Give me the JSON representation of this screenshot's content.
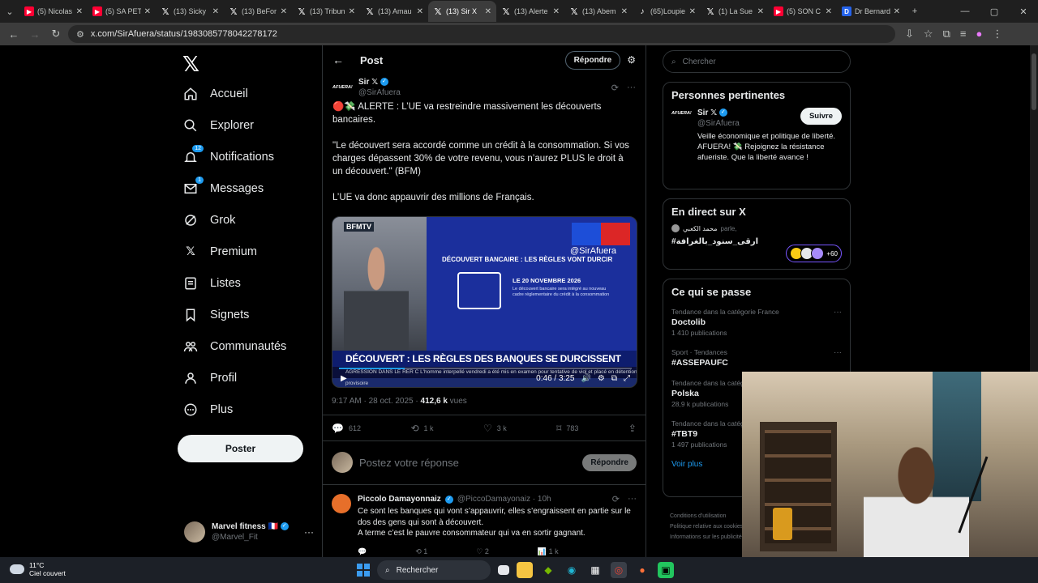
{
  "browser": {
    "tabs": [
      {
        "label": "(5) Nicolas",
        "icon": "youtube-icon"
      },
      {
        "label": "(5) SA PETI",
        "icon": "youtube-icon"
      },
      {
        "label": "(13) Sicky",
        "icon": "x-icon"
      },
      {
        "label": "(13) BeFor",
        "icon": "x-icon"
      },
      {
        "label": "(13) Tribun",
        "icon": "x-icon"
      },
      {
        "label": "(13) Amau",
        "icon": "x-icon"
      },
      {
        "label": "(13) Sir X",
        "icon": "x-icon",
        "active": true
      },
      {
        "label": "(13) Alerte",
        "icon": "x-icon"
      },
      {
        "label": "(13) Abem",
        "icon": "x-icon"
      },
      {
        "label": "(65)Loupie",
        "icon": "tiktok-icon"
      },
      {
        "label": "(1) La Sue",
        "icon": "x-icon"
      },
      {
        "label": "(5) SON C",
        "icon": "youtube-icon"
      },
      {
        "label": "Dr Bernard",
        "icon": "doc-icon"
      }
    ],
    "url": "x.com/SirAfuera/status/1983085778042278172"
  },
  "nav": {
    "items": [
      "Accueil",
      "Explorer",
      "Notifications",
      "Messages",
      "Grok",
      "Premium",
      "Listes",
      "Signets",
      "Communautés",
      "Profil",
      "Plus"
    ],
    "notif_badge": "12",
    "msg_badge": "1",
    "post_button": "Poster",
    "account_name": "Marvel fitness 🇫🇷",
    "account_handle": "@Marvel_Fit"
  },
  "post": {
    "header": "Post",
    "reply_button": "Répondre",
    "author_name": "Sir 𝕏",
    "author_handle": "@SirAfuera",
    "author_logo": "AFUERA!",
    "text_1": "🔴💸 ALERTE : L’UE va restreindre massivement les découverts bancaires.",
    "text_2": "\"Le découvert sera accordé comme un crédit à la consommation. Si vos charges dépassent 30% de votre revenu, vous n’aurez PLUS le droit à un découvert.\" (BFM)",
    "text_3": "L’UE va donc appauvrir des millions de Français.",
    "video": {
      "channel": "BFMTV",
      "handle_overlay": "@SirAfuera",
      "title": "DÉCOUVERT BANCAIRE : LES RÈGLES VONT DURCIR",
      "date": "LE 20 NOVEMBRE 2026",
      "desc": "Le découvert bancaire sera intégré au nouveau cadre réglementaire du crédit à la consommation",
      "banner": "DÉCOUVERT : LES RÈGLES DES BANQUES SE DURCISSENT",
      "ticker": "AGRESSION DANS LE RER C  L'homme interpellé vendredi a été mis en examen pour tentative de viol et placé en détention provisoire",
      "time": "0:46 / 3:25",
      "progress": 0.224
    },
    "timestamp": "9:17 AM · 28 oct. 2025 ·",
    "views_count": "412,6 k",
    "views_label": "vues",
    "stats": {
      "replies": "612",
      "reposts": "1 k",
      "likes": "3 k",
      "bookmarks": "783"
    },
    "reply_placeholder": "Postez votre réponse",
    "reply_submit": "Répondre"
  },
  "comment": {
    "name": "Piccolo Damayonnaiz",
    "handle": "@PiccoDamayonaiz · 10h",
    "text_1": "Ce sont les banques qui vont s’appauvrir, elles s’engraissent en partie sur le dos des gens qui sont à découvert.",
    "text_2": "A terme c’est le pauvre consommateur qui va en sortir gagnant.",
    "replies": "",
    "reposts": "1",
    "likes": "2",
    "views": "1 k"
  },
  "sidebar": {
    "search_placeholder": "Chercher",
    "people_title": "Personnes pertinentes",
    "person_name": "Sir 𝕏",
    "person_handle": "@SirAfuera",
    "follow_label": "Suivre",
    "person_bio": "Veille économique et politique de liberté. AFUERA! 💸 Rejoignez la résistance afueriste. Que la liberté avance !",
    "live_title": "En direct sur X",
    "live_user": "محمد الكعبي",
    "live_status": "parle,",
    "live_tag": "#ارقى_سنود_بالغرافة",
    "live_count": "+60",
    "trends_title": "Ce qui se passe",
    "trends": [
      {
        "cat": "Tendance dans la catégorie France",
        "name": "Doctolib",
        "count": "1 410 publications"
      },
      {
        "cat": "Sport · Tendances",
        "name": "#ASSEPAUFC",
        "count": ""
      },
      {
        "cat": "Tendance dans la catégorie France",
        "name": "Polska",
        "count": "28,9 k publications"
      },
      {
        "cat": "Tendance dans la catégorie France",
        "name": "#TBT9",
        "count": "1 497 publications"
      }
    ],
    "see_more": "Voir plus",
    "footer": [
      "Conditions d'utilisation",
      "Politique relative aux cookies",
      "Informations sur les publicités"
    ]
  },
  "taskbar": {
    "temp": "11°C",
    "weather": "Ciel couvert",
    "search": "Rechercher"
  },
  "colors": {
    "accent": "#1d9bf0",
    "bg": "#000000",
    "border": "#2f3336"
  }
}
